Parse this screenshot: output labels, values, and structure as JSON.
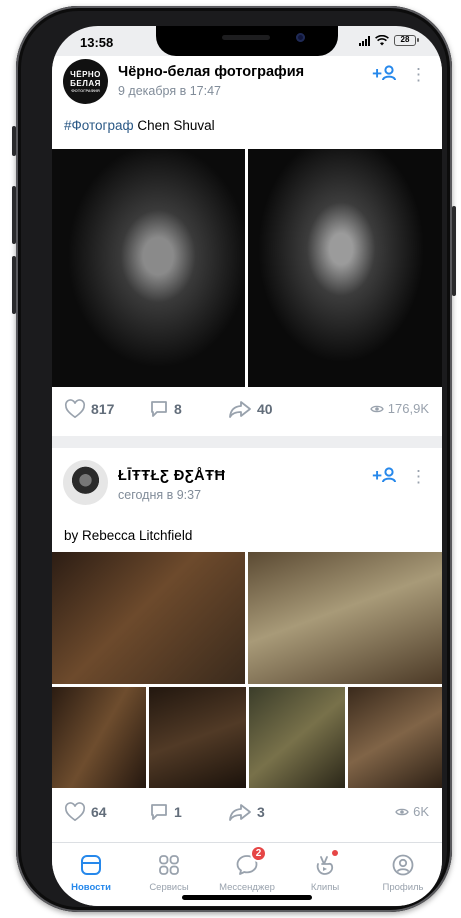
{
  "status_bar": {
    "time": "13:58",
    "battery": "28"
  },
  "posts": [
    {
      "avatar_lines": [
        "ЧЁРНО",
        "БЕЛАЯ",
        "ФОТОГРАФИЯ"
      ],
      "author": "Чёрно-белая фотография",
      "date": "9 декабря в 17:47",
      "follow_label": "+",
      "more_label": "⋮",
      "hashtag": "#Фотограф",
      "text": " Chen Shuval",
      "likes": "817",
      "comments": "8",
      "shares": "40",
      "views": "176,9K"
    },
    {
      "author": "ŁĪŦŦŁƸ ĐƸÅŦĦ",
      "date": "сегодня в 9:37",
      "follow_label": "+",
      "more_label": "⋮",
      "text": "by Rebecca Litchfield",
      "likes": "64",
      "comments": "1",
      "shares": "3",
      "views": "6K"
    }
  ],
  "tabbar": {
    "items": [
      {
        "label": "Новости",
        "icon": "news-icon",
        "active": true
      },
      {
        "label": "Сервисы",
        "icon": "services-icon"
      },
      {
        "label": "Мессенджер",
        "icon": "messenger-icon",
        "badge": "2"
      },
      {
        "label": "Клипы",
        "icon": "clips-icon"
      },
      {
        "label": "Профиль",
        "icon": "profile-icon"
      }
    ]
  },
  "colors": {
    "accent": "#2688eb",
    "badge": "#e64646",
    "muted": "#818c99"
  }
}
